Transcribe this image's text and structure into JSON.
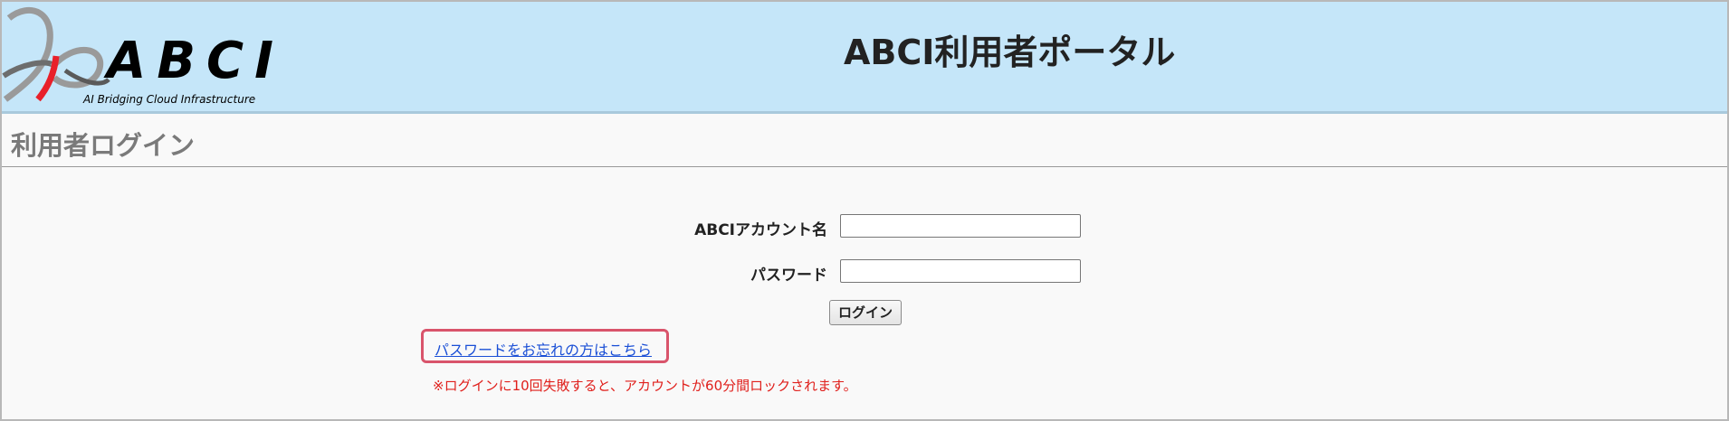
{
  "header": {
    "logo_text": "ABCI",
    "logo_subtitle": "AI Bridging Cloud Infrastructure",
    "title": "ABCI利用者ポータル"
  },
  "page": {
    "title": "利用者ログイン"
  },
  "form": {
    "account_label": "ABCIアカウント名",
    "account_value": "",
    "password_label": "パスワード",
    "password_value": "",
    "login_button": "ログイン",
    "forgot_link": "パスワードをお忘れの方はこちら",
    "warning": "※ログインに10回失敗すると、アカウントが60分間ロックされます。"
  },
  "colors": {
    "header_bg": "#c5e6f9",
    "link": "#1a4fd6",
    "warning": "#e0201c",
    "highlight_border": "#d9546b"
  }
}
